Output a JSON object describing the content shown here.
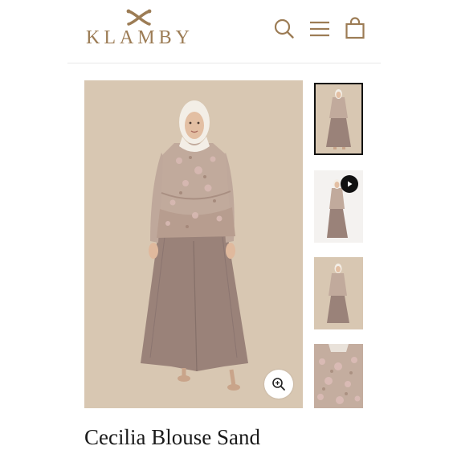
{
  "header": {
    "brand": "KLAMBY",
    "icons": [
      "search-icon",
      "menu-icon",
      "cart-icon"
    ]
  },
  "gallery": {
    "main_image": "woman in hijab wearing floral ruffled blouse and mauve wide-leg trousers",
    "thumbnails": [
      {
        "name": "front-view",
        "active": true
      },
      {
        "name": "video",
        "has_play": true
      },
      {
        "name": "side-view"
      },
      {
        "name": "fabric-detail"
      }
    ],
    "zoom_icon": "zoom-in-icon"
  },
  "product": {
    "title": "Cecilia Blouse Sand"
  },
  "colors": {
    "brand": "#9c7c55",
    "image_bg": "#d8c7b2",
    "pants": "#9a8279"
  }
}
